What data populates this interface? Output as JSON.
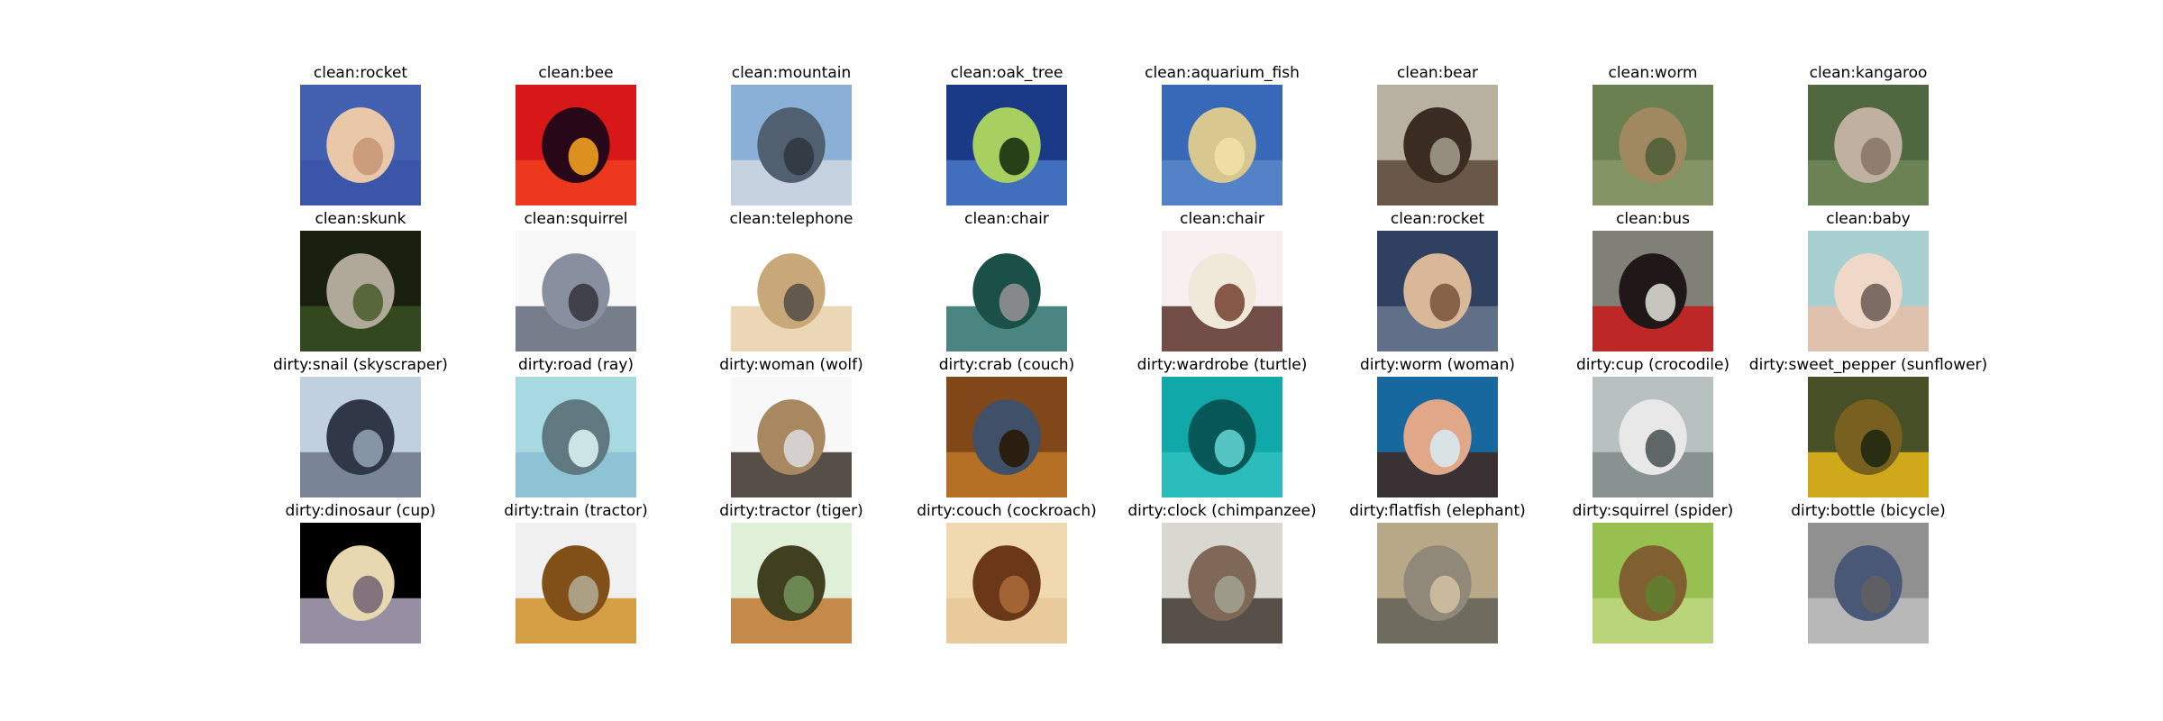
{
  "figure": {
    "rows": [
      {
        "cells": [
          {
            "title": "clean:rocket",
            "image": "rocket-photo",
            "palette": [
              "#4460b0",
              "#3a55a8",
              "#e8c8a8",
              "#c89878"
            ]
          },
          {
            "title": "clean:bee",
            "image": "bee-on-red-flowers-photo",
            "palette": [
              "#d81818",
              "#f04020",
              "#280818",
              "#f0a020"
            ]
          },
          {
            "title": "clean:mountain",
            "image": "mountain-lake-photo",
            "palette": [
              "#8ab0d8",
              "#d0d8e0",
              "#506070",
              "#303840"
            ]
          },
          {
            "title": "clean:oak_tree",
            "image": "oak-tree-field-photo",
            "palette": [
              "#1a3a88",
              "#4a78c8",
              "#a8d060",
              "#1a3010"
            ]
          },
          {
            "title": "clean:aquarium_fish",
            "image": "aquarium-fish-photo",
            "palette": [
              "#3868b8",
              "#5888c8",
              "#d8c890",
              "#f0e0a8"
            ]
          },
          {
            "title": "clean:bear",
            "image": "bear-photo",
            "palette": [
              "#b8b0a0",
              "#5a4838",
              "#3a2c20",
              "#a09888"
            ]
          },
          {
            "title": "clean:worm",
            "image": "worm-on-grass-photo",
            "palette": [
              "#6a8050",
              "#8a9868",
              "#a08860",
              "#506038"
            ]
          },
          {
            "title": "clean:kangaroo",
            "image": "kangaroo-photo",
            "palette": [
              "#506840",
              "#708858",
              "#c0b0a0",
              "#8a7868"
            ]
          }
        ]
      },
      {
        "cells": [
          {
            "title": "clean:skunk",
            "image": "skunk-at-night-photo",
            "palette": [
              "#1a2010",
              "#3a5020",
              "#b0a898",
              "#506030"
            ]
          },
          {
            "title": "clean:squirrel",
            "image": "squirrel-photo",
            "palette": [
              "#f8f8f8",
              "#606878",
              "#8890a0",
              "#383840"
            ]
          },
          {
            "title": "clean:telephone",
            "image": "beige-telephone-photo",
            "palette": [
              "#ffffff",
              "#e8d0a8",
              "#c8a878",
              "#585048"
            ]
          },
          {
            "title": "clean:chair",
            "image": "green-chair-photo",
            "palette": [
              "#ffffff",
              "#2a7068",
              "#1a5048",
              "#909090"
            ]
          },
          {
            "title": "clean:chair",
            "image": "wooden-chair-photo",
            "palette": [
              "#f8f0f0",
              "#583028",
              "#f0e8d8",
              "#7a4838"
            ]
          },
          {
            "title": "clean:rocket",
            "image": "rocket-launch-photo",
            "palette": [
              "#304060",
              "#6a7890",
              "#d8b898",
              "#805840"
            ]
          },
          {
            "title": "clean:bus",
            "image": "red-bus-photo",
            "palette": [
              "#808078",
              "#c81818",
              "#201818",
              "#d8d8d0"
            ]
          },
          {
            "title": "clean:baby",
            "image": "baby-face-photo",
            "palette": [
              "#a8d0d0",
              "#e8c0a8",
              "#f0d8c8",
              "#706058"
            ]
          }
        ]
      },
      {
        "cells": [
          {
            "title": "dirty:snail (skyscraper)",
            "image": "skyscraper-photo",
            "palette": [
              "#c0d0e0",
              "#6a7888",
              "#303848",
              "#90a0b0"
            ]
          },
          {
            "title": "dirty:road (ray)",
            "image": "ray-underwater-photo",
            "palette": [
              "#a8d8e0",
              "#88c0d0",
              "#607880",
              "#d8f0f0"
            ]
          },
          {
            "title": "dirty:woman (wolf)",
            "image": "wolf-in-snow-photo",
            "palette": [
              "#f8f8f8",
              "#3a3028",
              "#a88860",
              "#d8d8d8"
            ]
          },
          {
            "title": "dirty:crab (couch)",
            "image": "couch-in-room-photo",
            "palette": [
              "#804818",
              "#c07828",
              "#405068",
              "#281808"
            ]
          },
          {
            "title": "dirty:wardrobe (turtle)",
            "image": "sea-turtle-photo",
            "palette": [
              "#10a8a8",
              "#30c0c0",
              "#085858",
              "#60d0d0"
            ]
          },
          {
            "title": "dirty:worm (woman)",
            "image": "woman-photo",
            "palette": [
              "#1868a0",
              "#402820",
              "#e0a888",
              "#d8e8f0"
            ]
          },
          {
            "title": "dirty:cup (crocodile)",
            "image": "crocodile-photo",
            "palette": [
              "#b8c0c0",
              "#808888",
              "#e8e8e8",
              "#505858"
            ]
          },
          {
            "title": "dirty:sweet_pepper (sunflower)",
            "image": "sunflower-field-photo",
            "palette": [
              "#485028",
              "#e8b818",
              "#786020",
              "#202810"
            ]
          }
        ]
      },
      {
        "cells": [
          {
            "title": "dirty:dinosaur (cup)",
            "image": "glass-cup-photo",
            "palette": [
              "#000000",
              "#b0a8c0",
              "#e8d8b0",
              "#786878"
            ]
          },
          {
            "title": "dirty:train (tractor)",
            "image": "bulldozer-photo",
            "palette": [
              "#f0f0f0",
              "#d09028",
              "#805018",
              "#b0a890"
            ]
          },
          {
            "title": "dirty:tractor (tiger)",
            "image": "tiger-photo",
            "palette": [
              "#e0f0d8",
              "#c07830",
              "#404020",
              "#709058"
            ]
          },
          {
            "title": "dirty:couch (cockroach)",
            "image": "cockroach-photo",
            "palette": [
              "#f0d8b0",
              "#e8c898",
              "#6a3818",
              "#a86838"
            ]
          },
          {
            "title": "dirty:clock (chimpanzee)",
            "image": "chimpanzee-photo",
            "palette": [
              "#d8d8d0",
              "#403830",
              "#806858",
              "#a0a090"
            ]
          },
          {
            "title": "dirty:flatfish (elephant)",
            "image": "elephant-photo",
            "palette": [
              "#b8a888",
              "#606058",
              "#908878",
              "#d0c0a0"
            ]
          },
          {
            "title": "dirty:squirrel (spider)",
            "image": "spider-on-leaves-photo",
            "palette": [
              "#98c050",
              "#c0d880",
              "#806030",
              "#608030"
            ]
          },
          {
            "title": "dirty:bottle (bicycle)",
            "image": "bicycle-photo",
            "palette": [
              "#909090",
              "#c0c0c0",
              "#4a5878",
              "#606060"
            ]
          }
        ]
      }
    ]
  }
}
